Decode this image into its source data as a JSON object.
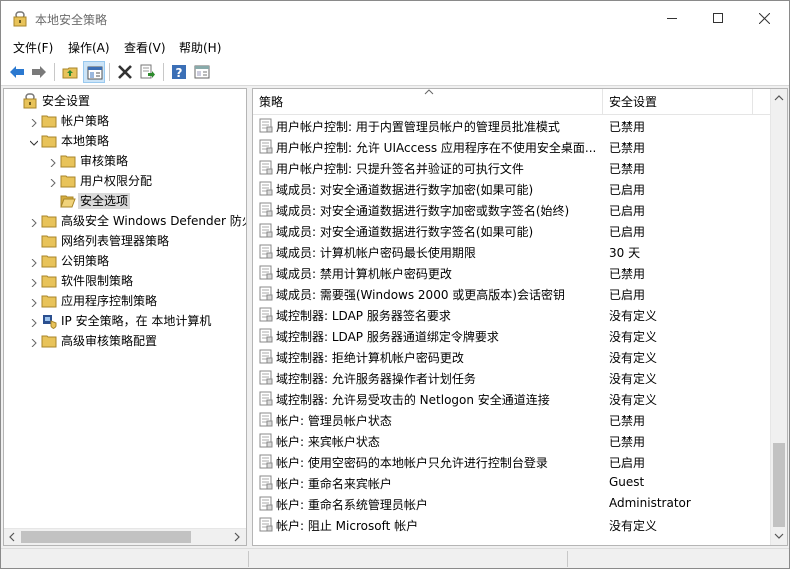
{
  "window": {
    "title": "本地安全策略",
    "icon": "security-policy-icon"
  },
  "menu": [
    {
      "label": "文件(F)"
    },
    {
      "label": "操作(A)"
    },
    {
      "label": "查看(V)"
    },
    {
      "label": "帮助(H)"
    }
  ],
  "toolbar": {
    "icons": [
      "back-arrow-icon",
      "forward-arrow-icon",
      "up-folder-icon",
      "show-hide-tree-icon",
      "delete-icon",
      "export-list-icon",
      "help-icon",
      "properties-icon"
    ]
  },
  "tree": [
    {
      "label": "安全设置",
      "level": 0,
      "expander": "none",
      "icon": "security-settings-icon"
    },
    {
      "label": "帐户策略",
      "level": 1,
      "expander": "collapsed",
      "icon": "folder-icon"
    },
    {
      "label": "本地策略",
      "level": 1,
      "expander": "expanded",
      "icon": "folder-icon"
    },
    {
      "label": "审核策略",
      "level": 2,
      "expander": "collapsed",
      "icon": "folder-icon"
    },
    {
      "label": "用户权限分配",
      "level": 2,
      "expander": "collapsed",
      "icon": "folder-icon"
    },
    {
      "label": "安全选项",
      "level": 2,
      "expander": "none",
      "icon": "folder-open-icon",
      "selected": true
    },
    {
      "label": "高级安全 Windows Defender 防火墙",
      "level": 1,
      "expander": "collapsed",
      "icon": "folder-icon"
    },
    {
      "label": "网络列表管理器策略",
      "level": 1,
      "expander": "none",
      "icon": "folder-icon"
    },
    {
      "label": "公钥策略",
      "level": 1,
      "expander": "collapsed",
      "icon": "folder-icon"
    },
    {
      "label": "软件限制策略",
      "level": 1,
      "expander": "collapsed",
      "icon": "folder-icon"
    },
    {
      "label": "应用程序控制策略",
      "level": 1,
      "expander": "collapsed",
      "icon": "folder-icon"
    },
    {
      "label": "IP 安全策略，在 本地计算机",
      "level": 1,
      "expander": "collapsed",
      "icon": "ip-security-icon"
    },
    {
      "label": "高级审核策略配置",
      "level": 1,
      "expander": "collapsed",
      "icon": "folder-icon"
    }
  ],
  "list": {
    "columns": {
      "policy": "策略",
      "setting": "安全设置"
    },
    "rows": [
      {
        "policy": "用户帐户控制: 用于内置管理员帐户的管理员批准模式",
        "setting": "已禁用"
      },
      {
        "policy": "用户帐户控制: 允许 UIAccess 应用程序在不使用安全桌面...",
        "setting": "已禁用"
      },
      {
        "policy": "用户帐户控制: 只提升签名并验证的可执行文件",
        "setting": "已禁用"
      },
      {
        "policy": "域成员: 对安全通道数据进行数字加密(如果可能)",
        "setting": "已启用"
      },
      {
        "policy": "域成员: 对安全通道数据进行数字加密或数字签名(始终)",
        "setting": "已启用"
      },
      {
        "policy": "域成员: 对安全通道数据进行数字签名(如果可能)",
        "setting": "已启用"
      },
      {
        "policy": "域成员: 计算机帐户密码最长使用期限",
        "setting": "30 天"
      },
      {
        "policy": "域成员: 禁用计算机帐户密码更改",
        "setting": "已禁用"
      },
      {
        "policy": "域成员: 需要强(Windows 2000 或更高版本)会话密钥",
        "setting": "已启用"
      },
      {
        "policy": "域控制器: LDAP 服务器签名要求",
        "setting": "没有定义"
      },
      {
        "policy": "域控制器: LDAP 服务器通道绑定令牌要求",
        "setting": "没有定义"
      },
      {
        "policy": "域控制器: 拒绝计算机帐户密码更改",
        "setting": "没有定义"
      },
      {
        "policy": "域控制器: 允许服务器操作者计划任务",
        "setting": "没有定义"
      },
      {
        "policy": "域控制器: 允许易受攻击的 Netlogon 安全通道连接",
        "setting": "没有定义"
      },
      {
        "policy": "帐户: 管理员帐户状态",
        "setting": "已禁用"
      },
      {
        "policy": "帐户: 来宾帐户状态",
        "setting": "已禁用"
      },
      {
        "policy": "帐户: 使用空密码的本地帐户只允许进行控制台登录",
        "setting": "已启用"
      },
      {
        "policy": "帐户: 重命名来宾帐户",
        "setting": "Guest"
      },
      {
        "policy": "帐户: 重命名系统管理员帐户",
        "setting": "Administrator"
      },
      {
        "policy": "帐户: 阻止 Microsoft 帐户",
        "setting": "没有定义"
      }
    ]
  },
  "colors": {
    "accent": "#2b79d0",
    "selection": "#d9d9d9",
    "folder": "#e8c35a"
  }
}
